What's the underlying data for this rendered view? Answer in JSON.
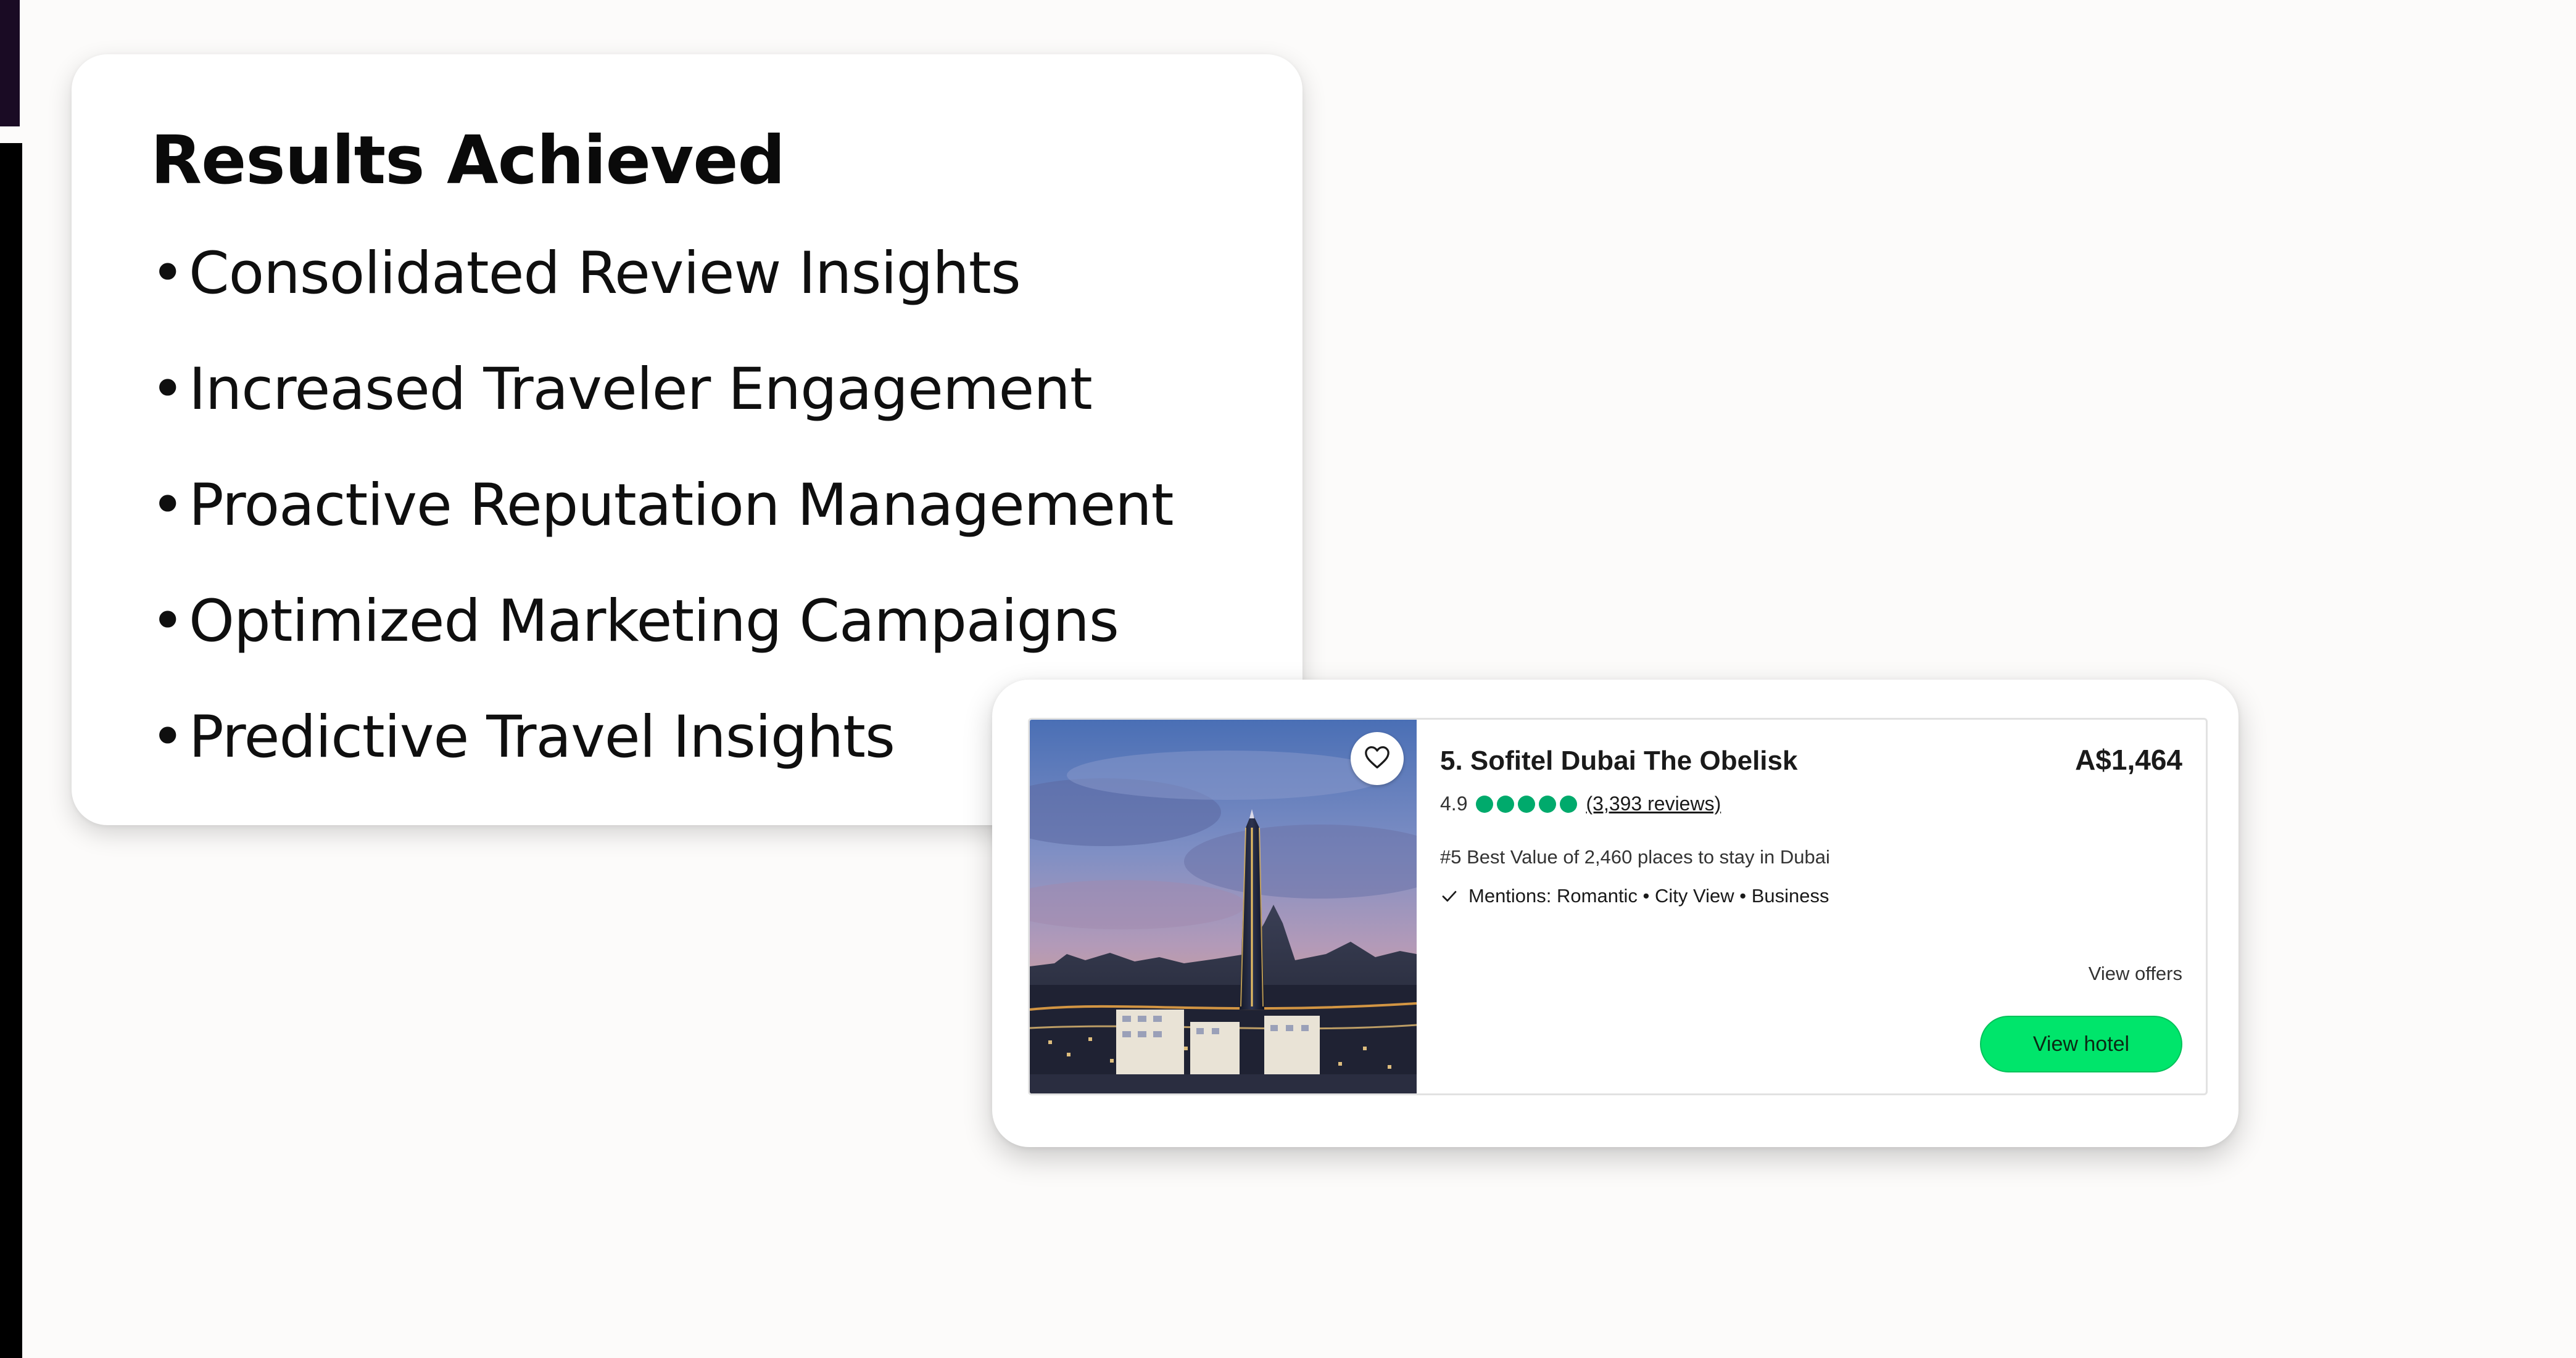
{
  "results": {
    "title": "Results Achieved",
    "bullet": "•",
    "items": [
      "Consolidated Review Insights",
      "Increased Traveler Engagement",
      "Proactive Reputation Management",
      "Optimized Marketing Campaigns",
      "Predictive Travel Insights"
    ]
  },
  "hotel": {
    "name": "5. Sofitel Dubai The Obelisk",
    "rating": "4.9",
    "bubbles": 5,
    "reviews_link": "(3,393 reviews)",
    "rank": "#5 Best Value of 2,460 places to stay in Dubai",
    "mentions": "Mentions: Romantic • City View • Business",
    "price": "A$1,464",
    "view_offers": "View offers",
    "view_hotel": "View hotel",
    "save_icon": "heart-icon",
    "check_icon": "check-icon"
  },
  "colors": {
    "background": "#fcfbfa",
    "rating_bubble": "#00aa6c",
    "button": "#00e56b",
    "left_edge_top": "#1a0b24",
    "left_edge_main": "#000000"
  }
}
